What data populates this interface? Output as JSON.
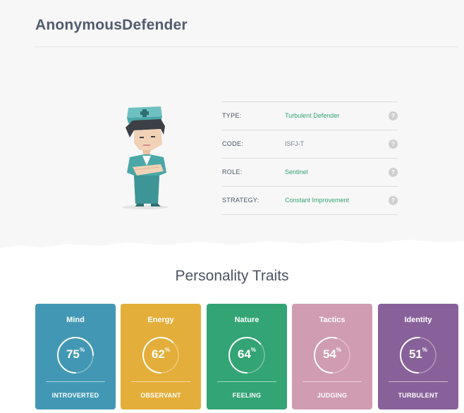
{
  "profile": {
    "username": "AnonymousDefender",
    "rows": [
      {
        "label": "TYPE:",
        "value": "Turbulent Defender",
        "link": true
      },
      {
        "label": "CODE:",
        "value": "ISFJ-T",
        "link": false
      },
      {
        "label": "ROLE:",
        "value": "Sentinel",
        "link": true
      },
      {
        "label": "STRATEGY:",
        "value": "Constant Improvement",
        "link": true
      }
    ],
    "help_glyph": "?"
  },
  "traits_section": {
    "title": "Personality Traits",
    "percent_sign": "%",
    "cards": [
      {
        "name": "Mind",
        "percent": "75",
        "value": 75,
        "result": "INTROVERTED",
        "color": "#4298b4"
      },
      {
        "name": "Energy",
        "percent": "62",
        "value": 62,
        "result": "OBSERVANT",
        "color": "#e4ae3a"
      },
      {
        "name": "Nature",
        "percent": "64",
        "value": 64,
        "result": "FEELING",
        "color": "#33a474"
      },
      {
        "name": "Tactics",
        "percent": "54",
        "value": 54,
        "result": "JUDGING",
        "color": "#d09cb2"
      },
      {
        "name": "Identity",
        "percent": "51",
        "value": 51,
        "result": "TURBULENT",
        "color": "#88619a"
      }
    ]
  },
  "colors": {
    "accent_teal": "#33a474",
    "background_band": "#f7f7f7",
    "text_dark": "#4b5262"
  },
  "icons": {
    "avatar": "defender-nurse-avatar",
    "help": "question-circle-icon"
  }
}
